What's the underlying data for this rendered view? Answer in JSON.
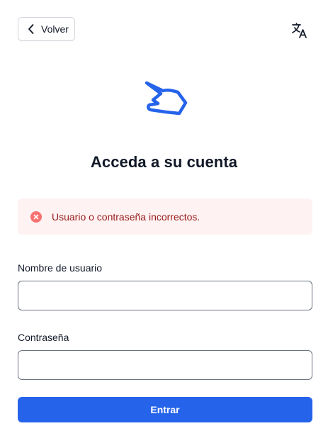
{
  "header": {
    "back_label": "Volver",
    "back_icon": "chevron-left-icon",
    "language_icon": "translate-icon"
  },
  "logo": {
    "icon": "pointing-hand-logo",
    "color": "#2563eb"
  },
  "title": "Acceda a su cuenta",
  "alert": {
    "icon": "x-circle-icon",
    "message": "Usuario o contraseña incorrectos.",
    "background": "#fef2f2",
    "text_color": "#991b1b",
    "icon_color": "#f87171"
  },
  "form": {
    "username_label": "Nombre de usuario",
    "username_value": "",
    "password_label": "Contraseña",
    "password_value": "",
    "submit_label": "Entrar"
  },
  "colors": {
    "accent": "#2563eb",
    "text": "#111827"
  }
}
